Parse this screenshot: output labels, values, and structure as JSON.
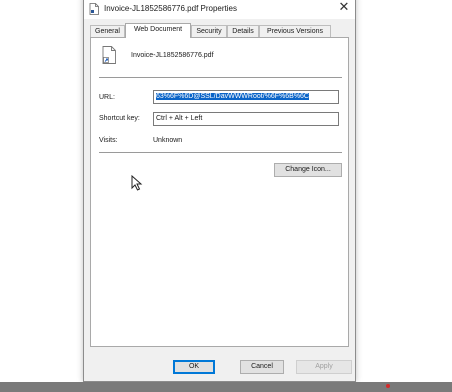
{
  "window": {
    "title": "Invoice-JL1852586776.pdf Properties",
    "close_glyph": "✕"
  },
  "tabs": [
    {
      "label": "General",
      "active": false
    },
    {
      "label": "Web Document",
      "active": true
    },
    {
      "label": "Security",
      "active": false
    },
    {
      "label": "Details",
      "active": false
    },
    {
      "label": "Previous Versions",
      "active": false
    }
  ],
  "file": {
    "name": "Invoice-JL1852586776.pdf"
  },
  "fields": {
    "url_label": "URL:",
    "url_value": "63%6F%6D@SSL/DavWWWRoot/%6F%6B%6C",
    "shortcut_label": "Shortcut key:",
    "shortcut_value": "Ctrl + Alt + Left",
    "visits_label": "Visits:",
    "visits_value": "Unknown"
  },
  "buttons": {
    "change_icon": "Change Icon...",
    "ok": "OK",
    "cancel": "Cancel",
    "apply": "Apply"
  },
  "colors": {
    "selection": "#0a64c8",
    "default_button_border": "#0078d7"
  }
}
